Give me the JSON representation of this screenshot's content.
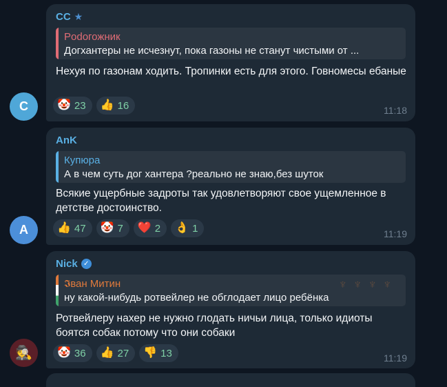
{
  "messages": [
    {
      "avatar_letter": "C",
      "avatar_color": "#4fa7d8",
      "sender": "CC",
      "sender_color": "#5ab0e4",
      "reply_name": "Podoгожник",
      "reply_color": "#e06c75",
      "reply_text": "Догхантеры не исчезнут, пока газоны не станут чистыми от ...",
      "text": "Нехуя по газонам ходить. Тропинки есть для этого. Говномесы ебаные",
      "reactions": [
        {
          "emoji": "🤡",
          "count": "23"
        },
        {
          "emoji": "👍",
          "count": "16"
        }
      ],
      "time": "11:18"
    },
    {
      "avatar_letter": "A",
      "avatar_color": "#4c8fd9",
      "sender": "AnK",
      "sender_color": "#5ab0e4",
      "reply_name": "Купюра",
      "reply_color": "#5ab0e4",
      "reply_text": "А в чем суть дог хантера ?реально не знаю,без шуток",
      "text": "Всякие ущербные задроты так удовлетворяют свое ущемленное в детстве достоинство.",
      "reactions": [
        {
          "emoji": "👍",
          "count": "47"
        },
        {
          "emoji": "🤡",
          "count": "7"
        },
        {
          "emoji": "❤️",
          "count": "2"
        },
        {
          "emoji": "👌",
          "count": "1"
        }
      ],
      "time": "11:19"
    },
    {
      "avatar_color": "#5a1f28",
      "sender": "Nick",
      "sender_color": "#5ab0e4",
      "reply_name": "𝕴ван Митин",
      "reply_color": "#e07a3c",
      "reply_text": "ну какой-нибудь ротвейлер не обглодает лицо ребёнка",
      "text": "Ротвейлеру нахер не нужно глодать ничьи лица, только идиоты боятся собак потому что они собаки",
      "reactions": [
        {
          "emoji": "🤡",
          "count": "36"
        },
        {
          "emoji": "👍",
          "count": "27"
        },
        {
          "emoji": "👎",
          "count": "13"
        }
      ],
      "time": "11:19"
    }
  ]
}
